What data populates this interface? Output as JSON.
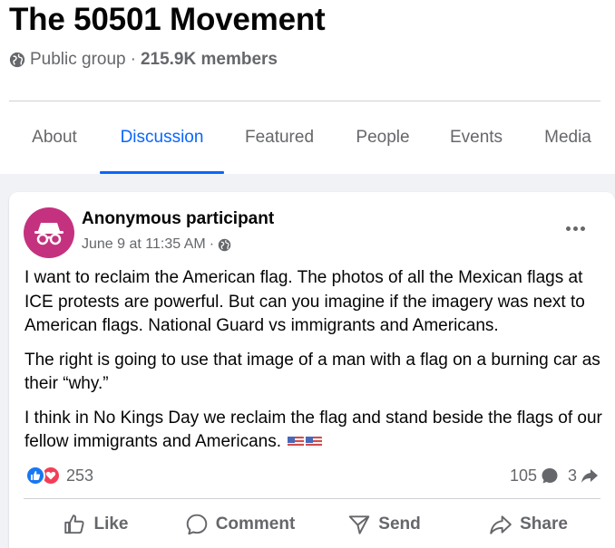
{
  "group": {
    "title": "The 50501 Movement",
    "privacy": "Public group",
    "separator": "·",
    "members": "215.9K members"
  },
  "tabs": [
    {
      "label": "About",
      "active": false
    },
    {
      "label": "Discussion",
      "active": true
    },
    {
      "label": "Featured",
      "active": false
    },
    {
      "label": "People",
      "active": false
    },
    {
      "label": "Events",
      "active": false
    },
    {
      "label": "Media",
      "active": false
    }
  ],
  "post": {
    "author": "Anonymous participant",
    "timestamp": "June 9 at 11:35 AM",
    "separator": "·",
    "avatar_icon": "incognito-icon",
    "paragraphs": [
      "I want to reclaim the American flag. The photos of all the Mexican flags at ICE protests are powerful. But can you imagine if the imagery was next to American flags. National Guard vs immigrants and Americans.",
      "The right is going to use that image of a man with a flag on a burning car as their “why.”",
      "I think in No Kings Day we reclaim the flag and stand beside the flags of our fellow immigrants and Americans."
    ],
    "reaction_count": "253",
    "comment_count": "105",
    "share_count": "3",
    "actions": {
      "like": "Like",
      "comment": "Comment",
      "send": "Send",
      "share": "Share"
    }
  },
  "colors": {
    "accent": "#0866ff",
    "avatar": "#c4327f",
    "like": "#1877f2",
    "love": "#f33e58"
  }
}
